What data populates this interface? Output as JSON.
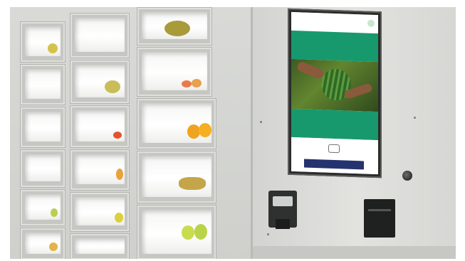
{
  "scene": {
    "colors": {
      "screen_green": "#17996d",
      "button_navy": "#25336e",
      "locker_grey": "#c6c7c3"
    },
    "kiosk_screen": {
      "logo_text": "",
      "banner_text": "",
      "band_text": "",
      "start_button_text": ""
    }
  }
}
